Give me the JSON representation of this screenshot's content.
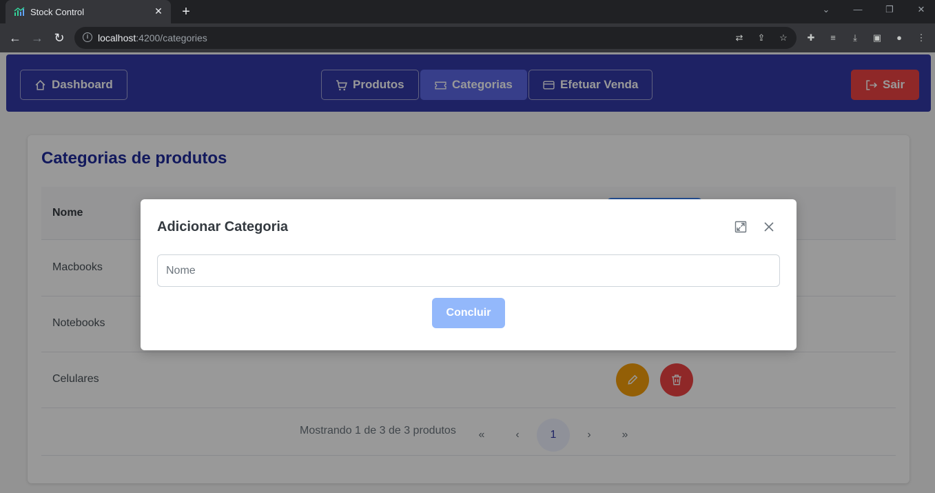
{
  "browser": {
    "tab_title": "Stock Control",
    "url_host": "localhost",
    "url_path": ":4200/categories"
  },
  "menu": {
    "dashboard": "Dashboard",
    "produtos": "Produtos",
    "categorias": "Categorias",
    "efetuar_venda": "Efetuar Venda",
    "sair": "Sair"
  },
  "card": {
    "title": "Categorias de produtos",
    "column_name": "Nome",
    "rows": [
      "Macbooks",
      "Notebooks",
      "Celulares"
    ]
  },
  "paginator": {
    "text": "Mostrando 1 de 3 de 3 produtos",
    "first": "«",
    "prev": "‹",
    "current_page": "1",
    "next": "›",
    "last": "»"
  },
  "dialog": {
    "title": "Adicionar Categoria",
    "input_placeholder": "Nome",
    "input_value": "",
    "submit_label": "Concluir"
  },
  "colors": {
    "menubar": "#3339a7",
    "primary": "#3b82f6",
    "warning": "#f59e0b",
    "danger": "#ef4444"
  }
}
